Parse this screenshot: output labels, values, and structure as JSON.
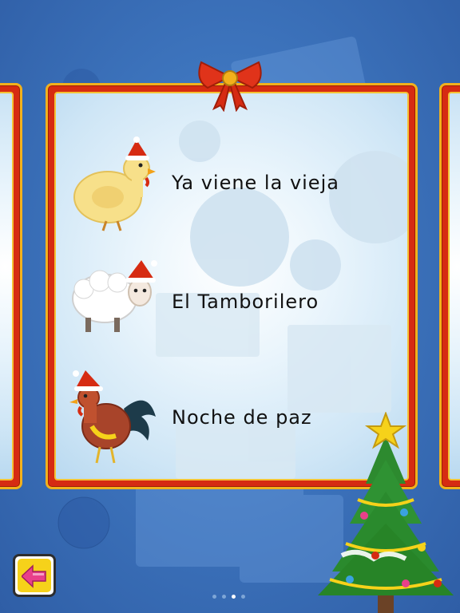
{
  "songs": [
    {
      "title": "Ya viene la vieja",
      "animal_icon": "hen-icon"
    },
    {
      "title": "El Tamborilero",
      "animal_icon": "sheep-icon"
    },
    {
      "title": "Noche de paz",
      "animal_icon": "rooster-icon"
    }
  ],
  "navigation": {
    "back_icon": "left-arrow-icon",
    "page_count": 4,
    "current_page": 3
  },
  "colors": {
    "background": "#3d74bd",
    "frame_red": "#d62b12",
    "frame_gold": "#f2b11c",
    "back_button_yellow": "#f6d21a",
    "arrow_pink": "#e8408a"
  }
}
